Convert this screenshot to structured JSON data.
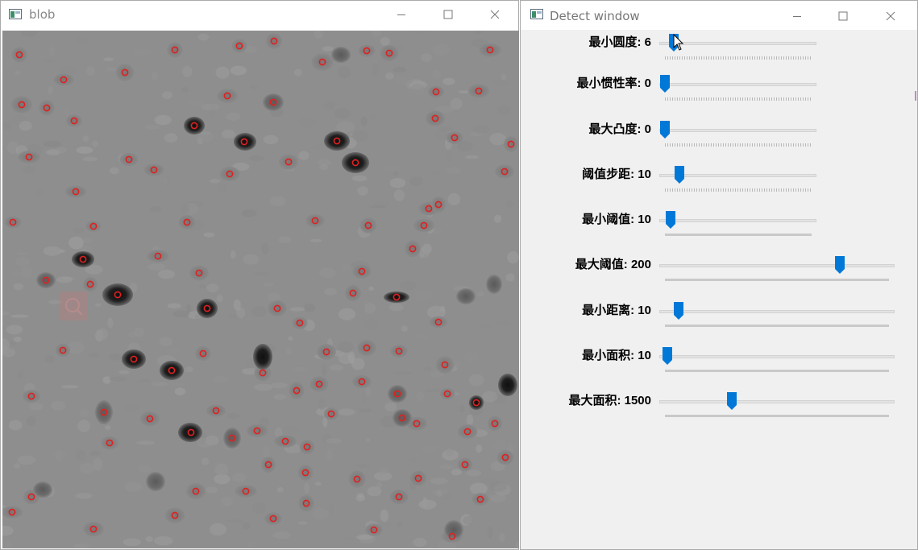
{
  "windows": {
    "blob": {
      "title": "blob"
    },
    "detect": {
      "title": "Detect window"
    }
  },
  "icons": {
    "app": "app-window-icon",
    "minimize": "minimize-icon",
    "maximize": "maximize-icon",
    "close": "close-icon",
    "zoom": "magnifier-icon",
    "cursor": "mouse-cursor-icon"
  },
  "colors": {
    "thumb": "#0078d7",
    "blob_marker": "#e02020",
    "panel_bg": "#f0f0f0"
  },
  "trackbars": [
    {
      "name": "最小圆度",
      "value": "6",
      "label": "最小圆度: 6",
      "fraction": 0.06
    },
    {
      "name": "最小惯性率",
      "value": "0",
      "label": "最小惯性率: 0",
      "fraction": 0.0
    },
    {
      "name": "最大凸度",
      "value": "0",
      "label": "最大凸度: 0",
      "fraction": 0.0
    },
    {
      "name": "阈值步距",
      "value": "10",
      "label": "阈值步距: 10",
      "fraction": 0.1
    },
    {
      "name": "最小阈值",
      "value": "10",
      "label": "最小阈值: 10",
      "fraction": 0.04
    },
    {
      "name": "最大阈值",
      "value": "200",
      "label": "最大阈值: 200",
      "fraction": 0.78
    },
    {
      "name": "最小距离",
      "value": "10",
      "label": "最小距离: 10",
      "fraction": 0.06
    },
    {
      "name": "最小面积",
      "value": "10",
      "label": "最小面积: 10",
      "fraction": 0.01
    },
    {
      "name": "最大面积",
      "value": "1500",
      "label": "最大面积: 1500",
      "fraction": 0.3
    }
  ]
}
